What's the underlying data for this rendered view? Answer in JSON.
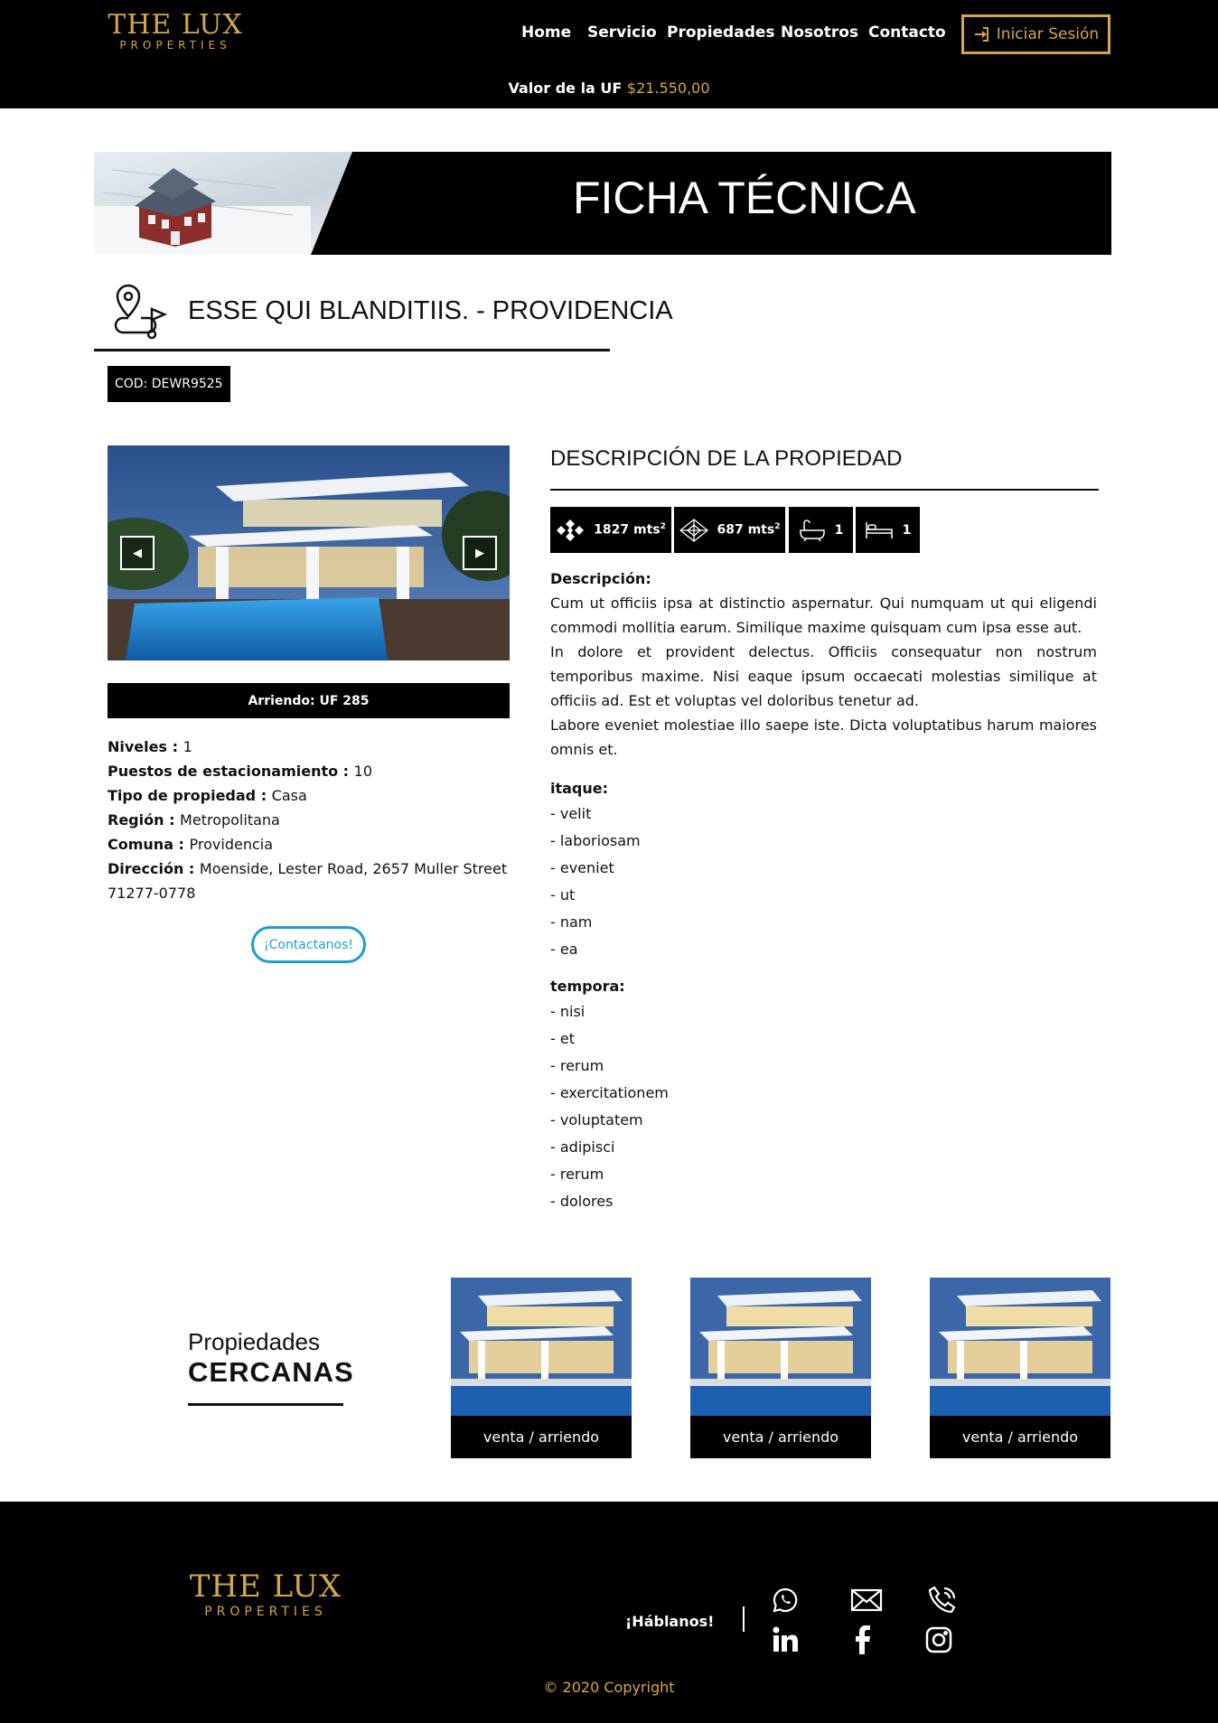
{
  "header": {
    "logo_main": "THE LUX",
    "logo_sub": "PROPERTIES",
    "nav": [
      "Home",
      "Servicio",
      "Propiedades",
      "Nosotros",
      "Contacto"
    ],
    "login_label": "Iniciar Sesión",
    "uf_label": "Valor de la UF",
    "uf_value": "$21.550,00"
  },
  "banner": {
    "title": "FICHA TÉCNICA"
  },
  "property": {
    "title": "ESSE QUI BLANDITIIS. - PROVIDENCIA",
    "code": "COD: DEWR9525",
    "price": "Arriendo: UF 285",
    "details": [
      {
        "label": "Niveles",
        "value": "1"
      },
      {
        "label": "Puestos de estacionamiento",
        "value": "10"
      },
      {
        "label": "Tipo de propiedad",
        "value": "Casa"
      },
      {
        "label": "Región",
        "value": "Metropolitana"
      },
      {
        "label": "Comuna",
        "value": "Providencia"
      },
      {
        "label": "Dirección",
        "value": "Moenside, Lester Road, 2657 Muller Street 71277-0778"
      }
    ],
    "contact_label": "¡Contactanos!"
  },
  "description": {
    "title": "DESCRIPCIÓN DE LA PROPIEDAD",
    "stats": {
      "total_area": "1827 mts",
      "built_area": "687 mts",
      "area_sup": "2",
      "baths": "1",
      "beds": "1"
    },
    "label": "Descripción:",
    "paragraphs": [
      "Cum ut officiis ipsa at distinctio aspernatur. Qui numquam ut qui eligendi commodi mollitia earum. Similique maxime quisquam cum ipsa esse aut.",
      "In dolore et provident delectus. Officiis consequatur non nostrum temporibus maxime. Nisi eaque ipsum occaecati molestias similique at officiis ad. Est et voluptas vel doloribus tenetur ad.",
      "Labore eveniet molestiae illo saepe iste. Dicta voluptatibus harum maiores omnis et."
    ],
    "lists": [
      {
        "title": "itaque:",
        "items": [
          "- velit",
          "- laboriosam",
          "- eveniet",
          "- ut",
          "- nam",
          "- ea"
        ]
      },
      {
        "title": "tempora:",
        "items": [
          "- nisi",
          "- et",
          "- rerum",
          "- exercitationem",
          "- voluptatem",
          "- adipisci",
          "- rerum",
          "- dolores"
        ]
      }
    ]
  },
  "nearby": {
    "title_a": "Propiedades",
    "title_b": "CERCANAS",
    "cards": [
      "venta / arriendo",
      "venta / arriendo",
      "venta / arriendo"
    ]
  },
  "footer": {
    "logo_main": "THE LUX",
    "logo_sub": "PROPERTIES",
    "hablanos": "¡Háblanos!",
    "social_icons": [
      "whatsapp-icon",
      "mail-icon",
      "phone-icon",
      "linkedin-icon",
      "facebook-icon",
      "instagram-icon"
    ],
    "copyright": "© 2020 Copyright"
  },
  "colors": {
    "accent": "#d4a845",
    "contact": "#1d9fc9",
    "dark": "#000000"
  }
}
